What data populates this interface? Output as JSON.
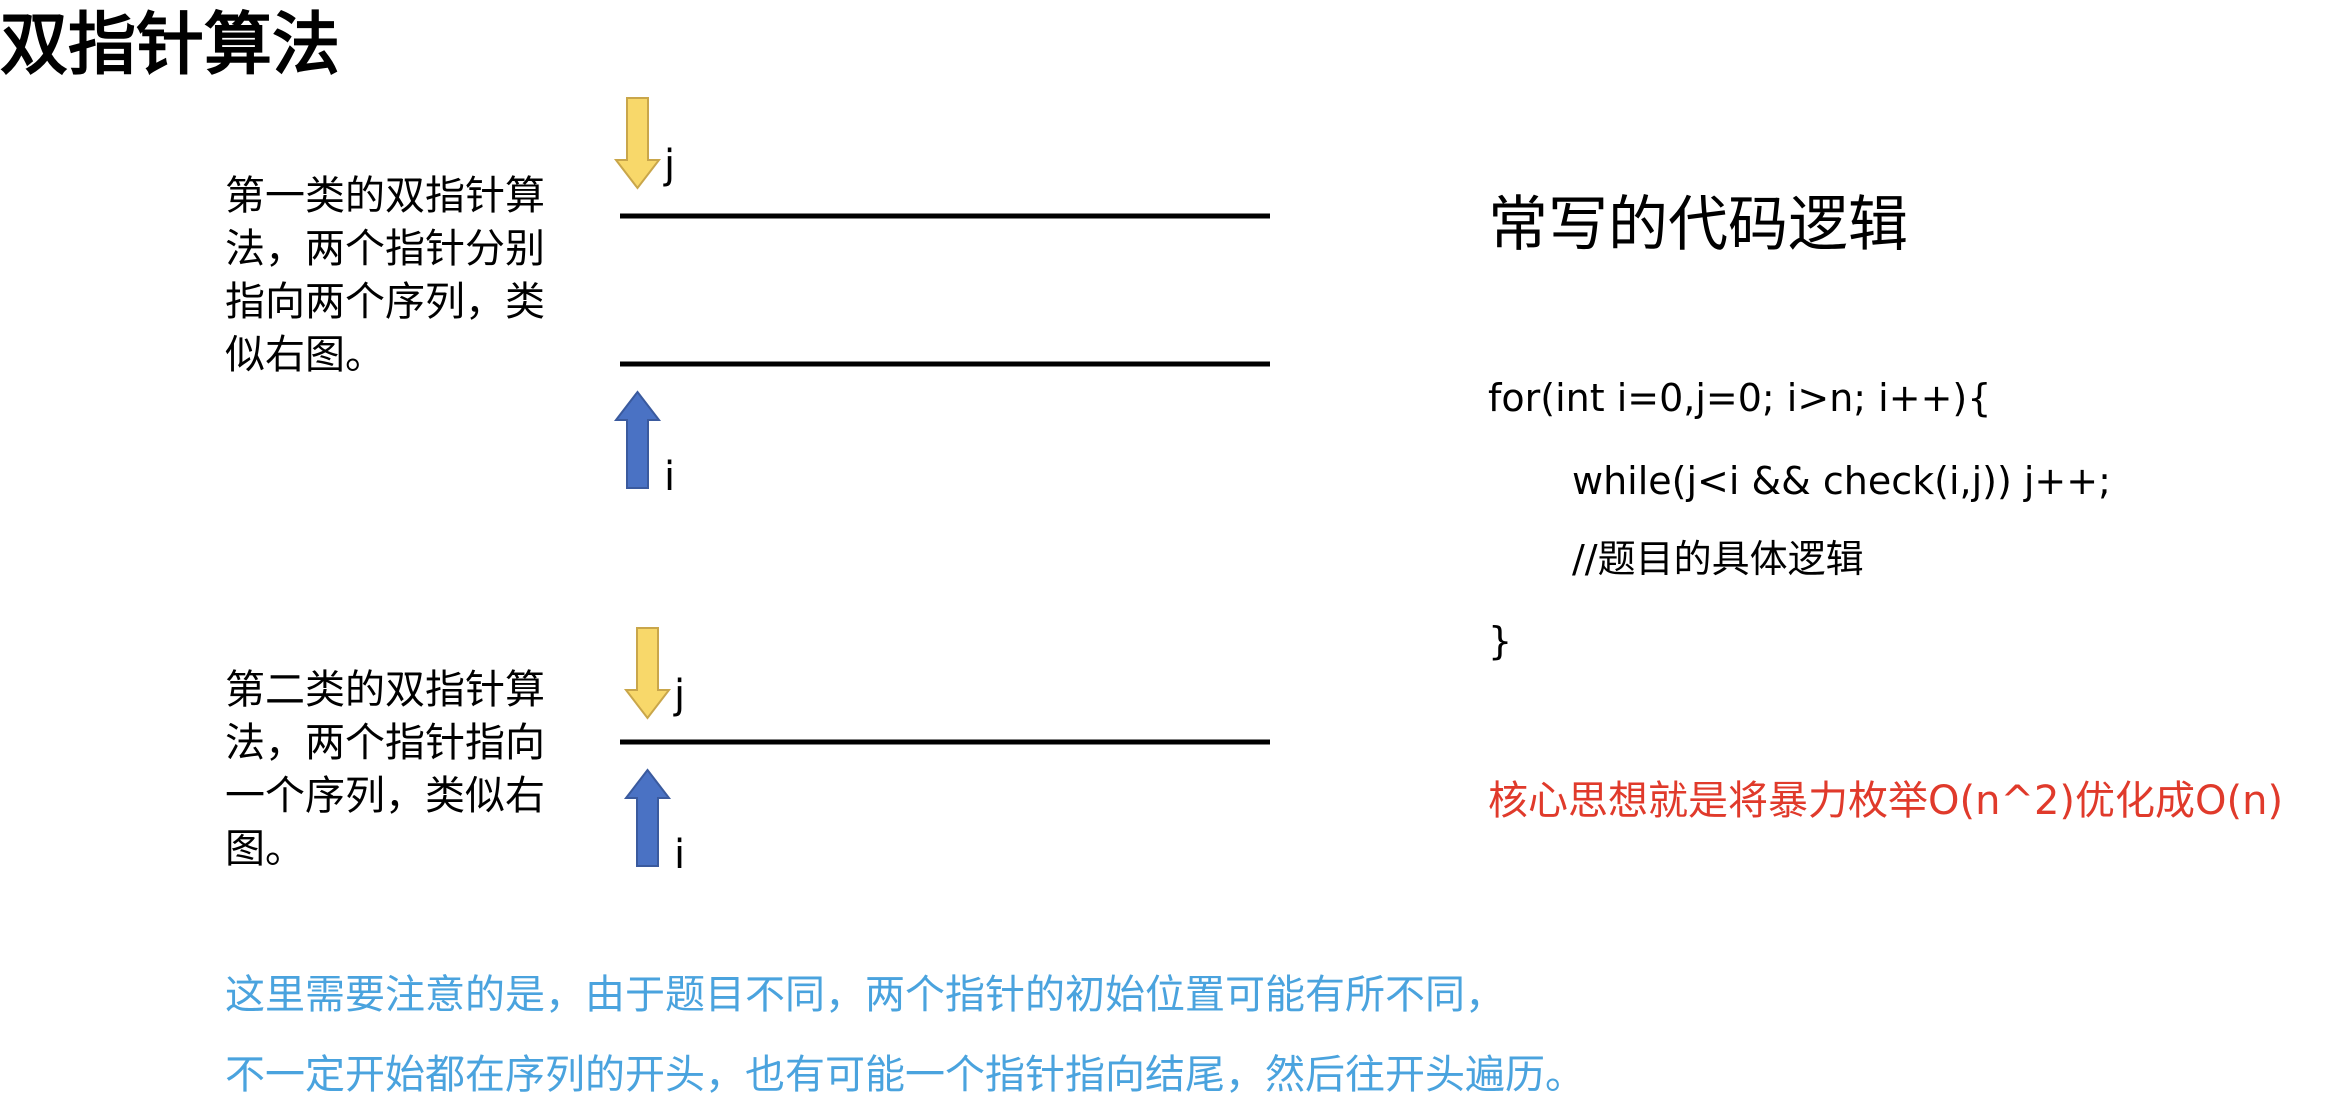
{
  "title": "双指针算法",
  "section1": {
    "description": "第一类的双指针算法，两个指针分别指向两个序列，类似右图。",
    "pointer_top_label": "j",
    "pointer_bottom_label": "i"
  },
  "section2": {
    "description": "第二类的双指针算法，两个指针指向一个序列，类似右图。",
    "pointer_top_label": "j",
    "pointer_bottom_label": "i"
  },
  "code": {
    "heading": "常写的代码逻辑",
    "lines": [
      "for(int i=0,j=0; i>n; i++){",
      "while(j<i && check(i,j)) j++;",
      "//题目的具体逻辑",
      "}"
    ]
  },
  "core_idea": "核心思想就是将暴力枚举O(n^2)优化成O(n)",
  "notes": [
    "这里需要注意的是，由于题目不同，两个指针的初始位置可能有所不同，",
    "不一定开始都在序列的开头，也有可能一个指针指向结尾，然后往开头遍历。"
  ],
  "colors": {
    "core_idea": "#e03a2b",
    "notes": "#4aa3de",
    "arrow_j": "#f8d86a",
    "arrow_j_stroke": "#c9a64a",
    "arrow_i": "#4a72c4",
    "arrow_i_stroke": "#3a5a9e",
    "sequence_line": "#000000"
  }
}
